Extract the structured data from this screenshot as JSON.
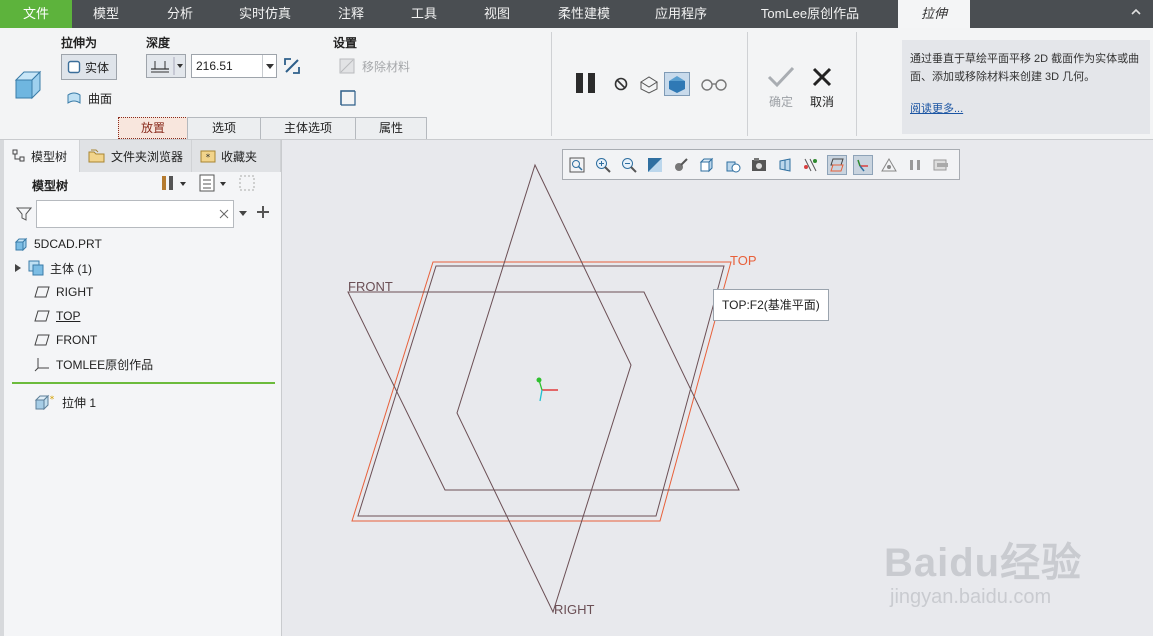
{
  "menu": {
    "file": "文件",
    "items": [
      "模型",
      "分析",
      "实时仿真",
      "注释",
      "工具",
      "视图",
      "柔性建模",
      "应用程序",
      "TomLee原创作品"
    ],
    "active_tab": "拉伸"
  },
  "ribbon": {
    "extrude_as_label": "拉伸为",
    "solid_label": "实体",
    "surface_label": "曲面",
    "depth_label": "深度",
    "depth_value": "216.51",
    "settings_label": "设置",
    "remove_material_label": "移除材料",
    "tabs": [
      "放置",
      "选项",
      "主体选项",
      "属性"
    ],
    "ok_label": "确定",
    "cancel_label": "取消",
    "help_text": "通过垂直于草绘平面平移 2D 截面作为实体或曲面、添加或移除材料来创建 3D 几何。",
    "help_link": "阅读更多..."
  },
  "left_panel": {
    "tabs": [
      "模型树",
      "文件夹浏览器",
      "收藏夹"
    ],
    "tree_title": "模型树",
    "search_value": "",
    "items": [
      "5DCAD.PRT",
      "主体 (1)",
      "RIGHT",
      "TOP",
      "FRONT",
      "TOMLEE原创作品"
    ],
    "new_feature": "拉伸 1"
  },
  "canvas": {
    "tooltip": "TOP:F2(基准平面)",
    "plane_labels": {
      "top": "TOP",
      "front": "FRONT",
      "right": "RIGHT"
    },
    "colors": {
      "top_plane": "#e8603a",
      "datum_plane": "#6b4f55"
    }
  },
  "watermark": {
    "brand": "Baidu经验",
    "url": "jingyan.baidu.com"
  }
}
